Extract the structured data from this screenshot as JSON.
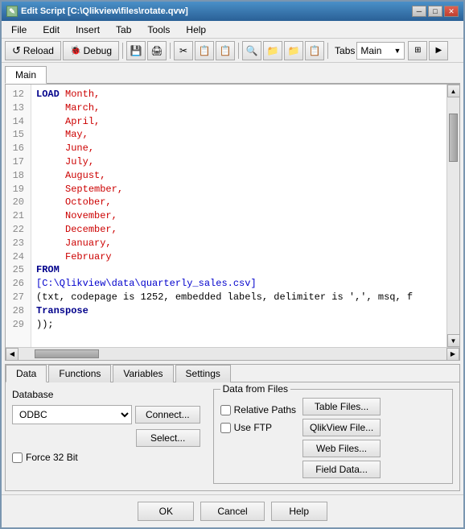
{
  "window": {
    "title": "Edit Script [C:\\Qlikview\\files\\rotate.qvw]",
    "icon": "✎"
  },
  "titlebar": {
    "minimize": "─",
    "maximize": "□",
    "close": "✕"
  },
  "menu": {
    "items": [
      "File",
      "Edit",
      "Insert",
      "Tab",
      "Tools",
      "Help"
    ]
  },
  "toolbar": {
    "reload_label": "Reload",
    "debug_label": "Debug",
    "tabs_label": "Tabs",
    "tabs_value": "Main",
    "icons": [
      "💾",
      "🖨",
      "✂",
      "📋",
      "📋",
      "🔍",
      "📁",
      "📁",
      "📋"
    ]
  },
  "script_area": {
    "tab": "Main",
    "lines": [
      {
        "num": "12",
        "code_parts": [
          {
            "type": "kw",
            "text": "LOAD"
          },
          {
            "type": "field",
            "text": " Month,"
          }
        ]
      },
      {
        "num": "13",
        "code_parts": [
          {
            "type": "field",
            "text": "      March,"
          }
        ]
      },
      {
        "num": "14",
        "code_parts": [
          {
            "type": "field",
            "text": "      April,"
          }
        ]
      },
      {
        "num": "15",
        "code_parts": [
          {
            "type": "field",
            "text": "      May,"
          }
        ]
      },
      {
        "num": "16",
        "code_parts": [
          {
            "type": "field",
            "text": "      June,"
          }
        ]
      },
      {
        "num": "17",
        "code_parts": [
          {
            "type": "field",
            "text": "      July,"
          }
        ]
      },
      {
        "num": "18",
        "code_parts": [
          {
            "type": "field",
            "text": "      August,"
          }
        ]
      },
      {
        "num": "19",
        "code_parts": [
          {
            "type": "field",
            "text": "      September,"
          }
        ]
      },
      {
        "num": "20",
        "code_parts": [
          {
            "type": "field",
            "text": "      October,"
          }
        ]
      },
      {
        "num": "21",
        "code_parts": [
          {
            "type": "field",
            "text": "      November,"
          }
        ]
      },
      {
        "num": "22",
        "code_parts": [
          {
            "type": "field",
            "text": "      December,"
          }
        ]
      },
      {
        "num": "23",
        "code_parts": [
          {
            "type": "field",
            "text": "      January,"
          }
        ]
      },
      {
        "num": "24",
        "code_parts": [
          {
            "type": "field",
            "text": "      February"
          }
        ]
      },
      {
        "num": "25",
        "code_parts": [
          {
            "type": "kw",
            "text": "FROM"
          }
        ]
      },
      {
        "num": "26",
        "code_parts": [
          {
            "type": "path",
            "text": "[C:\\Qlikview\\data\\quarterly_sales.csv]"
          }
        ]
      },
      {
        "num": "27",
        "code_parts": [
          {
            "type": "normal",
            "text": "(txt, codepage is 1252, embedded labels, delimiter is ','"
          },
          {
            "type": "normal",
            "text": ", msq, f"
          }
        ]
      },
      {
        "num": "28",
        "code_parts": [
          {
            "type": "kw",
            "text": "Transpose"
          }
        ]
      },
      {
        "num": "29",
        "code_parts": [
          {
            "type": "normal",
            "text": "));"
          }
        ]
      }
    ]
  },
  "bottom_panel": {
    "tabs": [
      "Data",
      "Functions",
      "Variables",
      "Settings"
    ],
    "active_tab": "Data",
    "data_tab": {
      "database_label": "Database",
      "database_value": "ODBC",
      "connect_label": "Connect...",
      "select_label": "Select...",
      "force32bit_label": "Force 32 Bit",
      "data_from_files_label": "Data from Files",
      "relative_paths_label": "Relative Paths",
      "use_ftp_label": "Use FTP",
      "table_files_label": "Table Files...",
      "qlikview_file_label": "QlikView File...",
      "web_files_label": "Web Files...",
      "field_data_label": "Field Data..."
    }
  },
  "dialog_buttons": {
    "ok": "OK",
    "cancel": "Cancel",
    "help": "Help"
  }
}
